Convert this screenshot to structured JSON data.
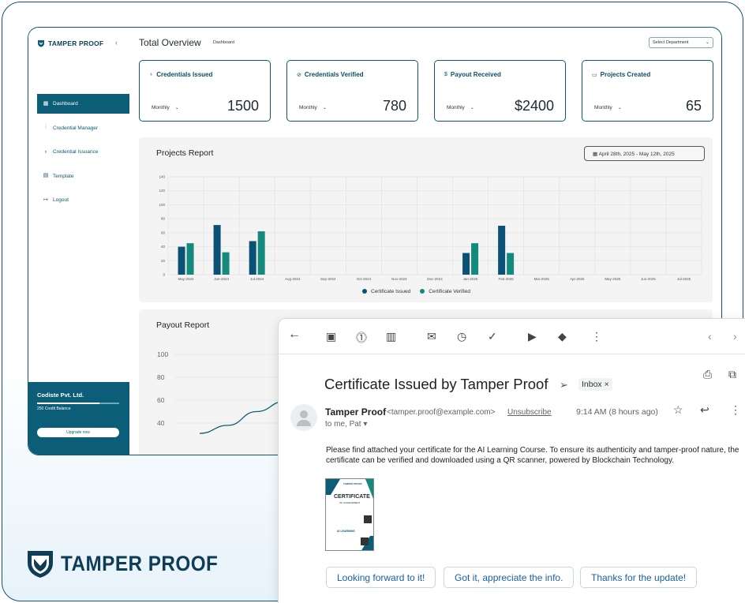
{
  "brand": {
    "name": "TAMPER PROOF",
    "color": "#0b5d78"
  },
  "sidebar": {
    "items": [
      {
        "label": "Dashboard",
        "icon": "grid-icon",
        "active": true
      },
      {
        "label": "Credential Manager",
        "icon": "sliders-icon",
        "active": false
      },
      {
        "label": "Credential Issuance",
        "icon": "award-icon",
        "active": false
      },
      {
        "label": "Template",
        "icon": "template-icon",
        "active": false
      },
      {
        "label": "Logout",
        "icon": "logout-icon",
        "active": false
      }
    ],
    "company": "Codiste Pvt. Ltd.",
    "credit_balance": "250 Credit Balance",
    "upgrade_label": "Upgrade now"
  },
  "header": {
    "title": "Total Overview",
    "breadcrumb": "Dashboard",
    "department_placeholder": "Select Department"
  },
  "cards": [
    {
      "label": "Credentials Issued",
      "icon": "award-icon",
      "period": "Monthly",
      "value": "1500"
    },
    {
      "label": "Credentials Verified",
      "icon": "check-circle-icon",
      "period": "Monthly",
      "value": "780"
    },
    {
      "label": "Payout Received",
      "icon": "dollar-icon",
      "period": "Monthly",
      "value": "$2400"
    },
    {
      "label": "Projects Created",
      "icon": "folder-icon",
      "period": "Monthly",
      "value": "65"
    }
  ],
  "projects_report": {
    "title": "Projects Report",
    "date_range": "April 28th, 2025 - May 12th, 2025"
  },
  "payout_report": {
    "title": "Payout Report"
  },
  "chart_data": [
    {
      "type": "bar",
      "title": "Projects Report",
      "categories": [
        "May-2024",
        "Jun-2024",
        "Jul-2024",
        "Aug-2024",
        "Sep-2024",
        "Oct-2024",
        "Nov-2024",
        "Dec-2024",
        "Jan-2025",
        "Feb-2025",
        "Mar-2025",
        "Apr-2025",
        "May-2025",
        "Jun-2025",
        "Jul-2025"
      ],
      "series": [
        {
          "name": "Certificate Issued",
          "color": "#0b5175",
          "values": [
            40,
            71,
            48,
            0,
            0,
            0,
            0,
            0,
            31,
            70,
            0,
            0,
            0,
            0,
            0
          ]
        },
        {
          "name": "Certificate Verified",
          "color": "#138a7c",
          "values": [
            45,
            32,
            62,
            0,
            0,
            0,
            0,
            0,
            45,
            31,
            0,
            0,
            0,
            0,
            0
          ]
        }
      ],
      "yticks": [
        0,
        20,
        40,
        60,
        80,
        100,
        120,
        140
      ],
      "ylim": [
        0,
        140
      ],
      "grid": true,
      "legend": "bottom-center"
    },
    {
      "type": "line",
      "title": "Payout Report",
      "yticks": [
        40,
        60,
        80,
        100
      ],
      "ylim": [
        20,
        100
      ],
      "series": [
        {
          "color": "#0b5d78",
          "x": [
            0,
            1,
            2,
            3,
            4
          ],
          "values": [
            31,
            38,
            50,
            59,
            64
          ]
        }
      ]
    }
  ],
  "email": {
    "subject": "Certificate Issued by Tamper Proof",
    "label": "Inbox",
    "sender_name": "Tamper Proof",
    "sender_address": "<tamper.proof@example.com>",
    "unsubscribe": "Unsubscribe",
    "time": "9:14 AM (8 hours ago)",
    "to": "to me, Pat",
    "body": "Please find attached your certificate for the AI Learning Course. To ensure its authenticity and tamper-proof nature, the certificate can be verified and downloaded using a QR scanner, powered by Blockchain Technology.",
    "attachment": {
      "brand": "TAMPER PROOF",
      "title": "CERTIFICATE",
      "subtitle": "OF ACHIEVEMENT",
      "course": "AI LEARNING"
    },
    "smart_replies": [
      "Looking forward to it!",
      "Got it, appreciate the info.",
      "Thanks for the update!"
    ]
  }
}
